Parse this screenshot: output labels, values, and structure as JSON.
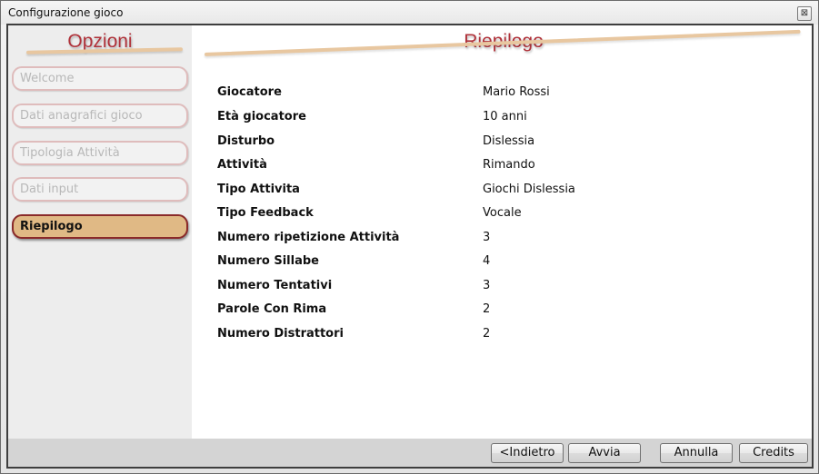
{
  "window": {
    "title": "Configurazione gioco",
    "close_glyph": "⊠"
  },
  "sidebar": {
    "title": "Opzioni",
    "items": [
      {
        "label": "Welcome",
        "active": false
      },
      {
        "label": "Dati anagrafici gioco",
        "active": false
      },
      {
        "label": "Tipologia Attività",
        "active": false
      },
      {
        "label": "Dati input",
        "active": false
      },
      {
        "label": "Riepilogo",
        "active": true
      }
    ]
  },
  "main": {
    "title": "Riepilogo",
    "rows": [
      {
        "label": "Giocatore",
        "value": "Mario Rossi"
      },
      {
        "label": "Età giocatore",
        "value": "10 anni"
      },
      {
        "label": "Disturbo",
        "value": "Dislessia"
      },
      {
        "label": "Attività",
        "value": "Rimando"
      },
      {
        "label": "Tipo Attivita",
        "value": "Giochi Dislessia"
      },
      {
        "label": "Tipo Feedback",
        "value": "Vocale"
      },
      {
        "label": "Numero ripetizione Attività",
        "value": "3"
      },
      {
        "label": "Numero Sillabe",
        "value": "4"
      },
      {
        "label": "Numero Tentativi",
        "value": "3"
      },
      {
        "label": "Parole Con Rima",
        "value": "2"
      },
      {
        "label": "Numero Distrattori",
        "value": "2"
      }
    ]
  },
  "footer": {
    "back_label": "<Indietro",
    "start_label": "Avvia",
    "cancel_label": "Annulla",
    "credits_label": "Credits"
  },
  "colors": {
    "accent_title": "#b0323a",
    "active_item_bg": "#e0b985",
    "underline": "#e8c7a0"
  }
}
